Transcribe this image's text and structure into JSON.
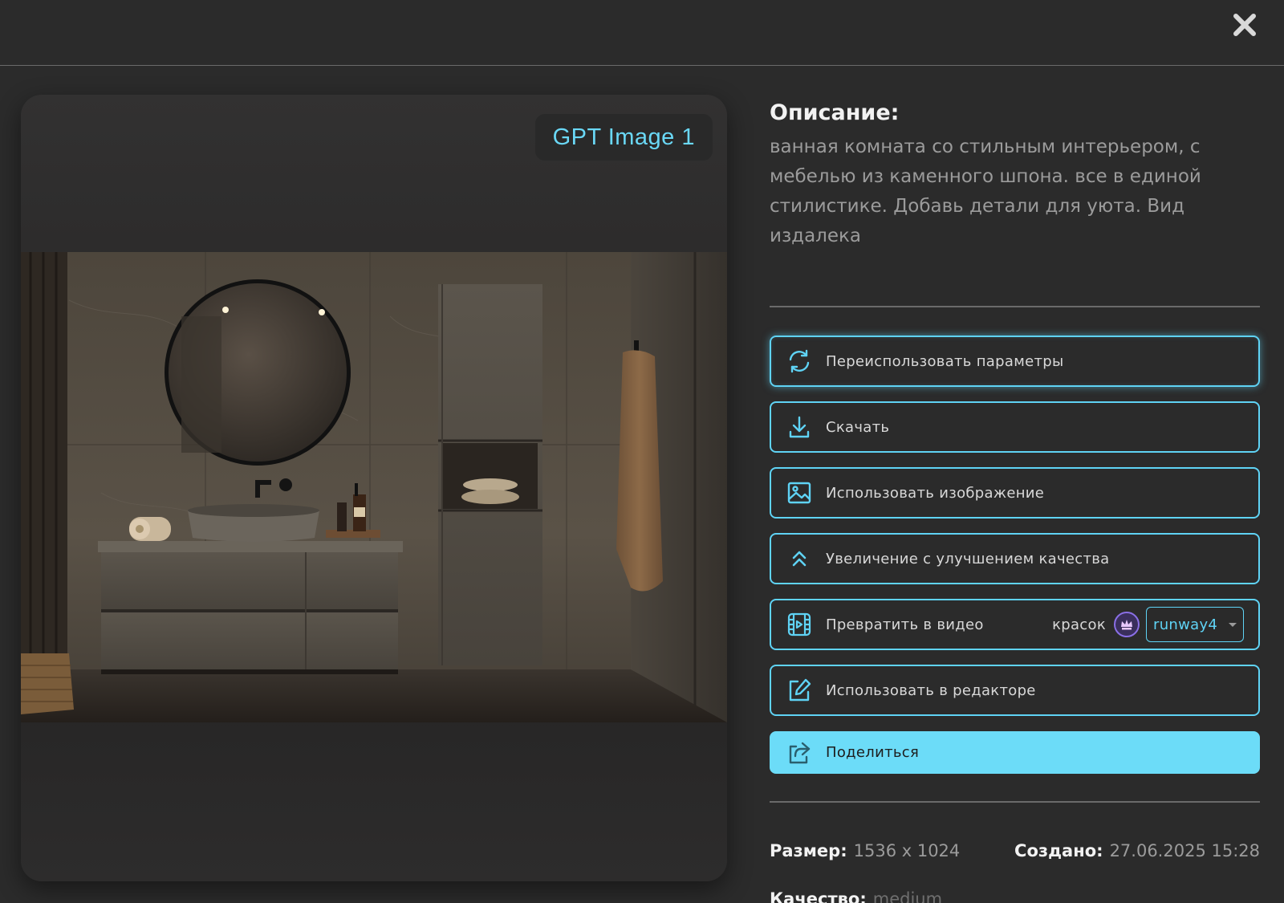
{
  "header": {
    "close_icon": "close-icon"
  },
  "image": {
    "model_badge": "GPT Image 1"
  },
  "description": {
    "heading": "Описание:",
    "text": "ванная комната со стильным интерьером, с мебелью из каменного шпона. все в единой стилистике. Добавь детали для уюта. Вид издалека"
  },
  "actions": {
    "reuse": {
      "label": "Переиспользовать параметры",
      "icon": "refresh-icon"
    },
    "download": {
      "label": "Скачать",
      "icon": "download-icon"
    },
    "use_image": {
      "label": "Использовать изображение",
      "icon": "image-icon"
    },
    "upscale": {
      "label": "Увеличение с улучшением качества",
      "icon": "chevrons-up-icon"
    },
    "to_video": {
      "label": "Превратить в видео",
      "icon": "video-icon",
      "paint_label": "красок",
      "model_select": "runway4"
    },
    "editor": {
      "label": "Использовать в редакторе",
      "icon": "edit-icon"
    },
    "share": {
      "label": "Поделиться",
      "icon": "share-icon"
    }
  },
  "meta": {
    "size_label": "Размер:",
    "size_value": "1536 x 1024",
    "created_label": "Создано:",
    "created_value": "27.06.2025 15:28",
    "quality_label": "Качество:",
    "quality_value": "medium"
  },
  "colors": {
    "background": "#2b2b2b",
    "accent": "#5fd3f5",
    "primary_button": "#6cdcf8"
  }
}
